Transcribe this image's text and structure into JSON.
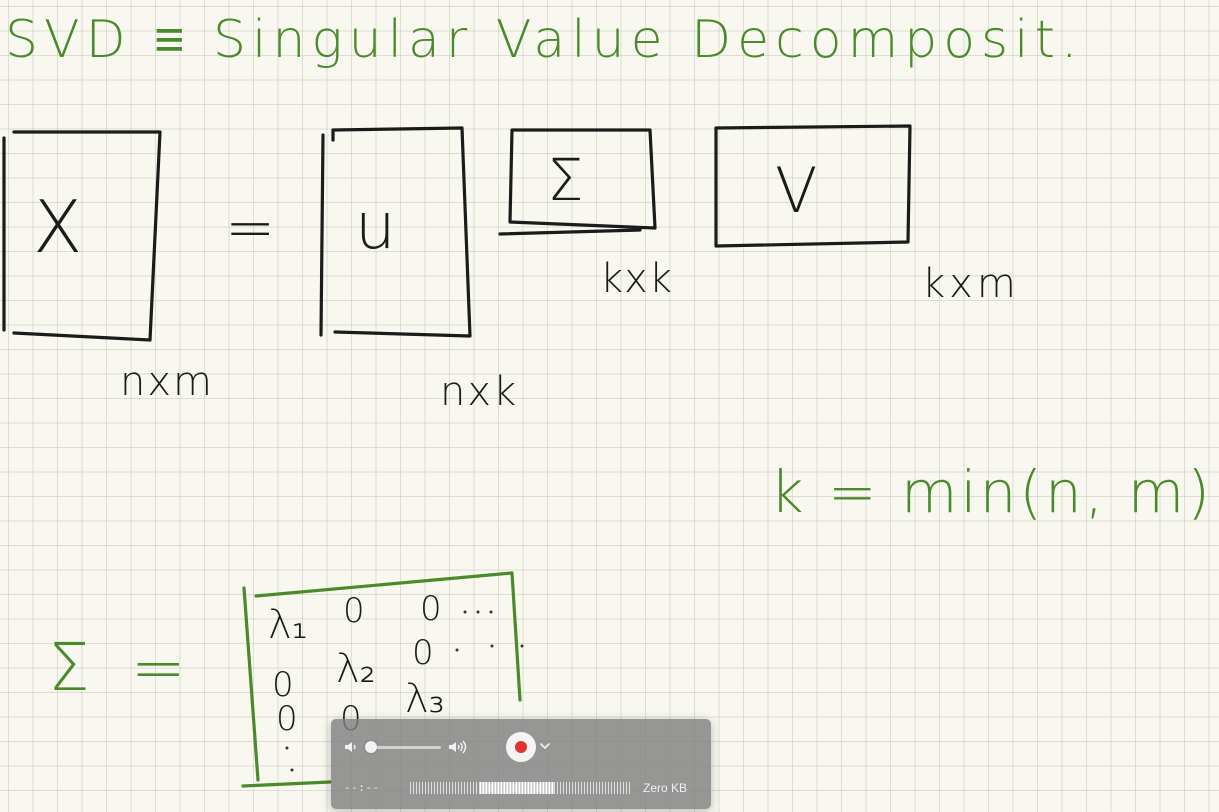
{
  "whiteboard": {
    "title": "SVD ≡ Singular Value Decomposit.",
    "matrix_x": "X",
    "equals": "=",
    "matrix_u": "u",
    "matrix_sigma": "Σ",
    "matrix_v": "V",
    "dim_x": "nxm",
    "dim_u": "nxk",
    "dim_sigma": "kxk",
    "dim_v": "kxm",
    "k_formula": "k = min(n, m)",
    "sigma_lhs": "Σ =",
    "sigma_entries": {
      "r1c1": "λ₁",
      "r1c2": "0",
      "r1c3": "0",
      "r2c1": "0",
      "r2c2": "λ₂",
      "r2c3": "0",
      "r3c1": "0",
      "r3c2": "0",
      "r3c3": "λ₃"
    },
    "colors": {
      "green_ink": "#4a8a2b",
      "black_ink": "#1b1b1b",
      "paper": "#f8f7f0"
    }
  },
  "recorder": {
    "time": "--:--",
    "file_size": "Zero KB",
    "volume_level": 0.05,
    "input_level": 0.45,
    "icons": {
      "volume_low": "speaker-low-icon",
      "volume_high": "speaker-high-icon",
      "record": "record-icon",
      "options": "chevron-down-icon"
    },
    "record_color": "#e3342f"
  }
}
